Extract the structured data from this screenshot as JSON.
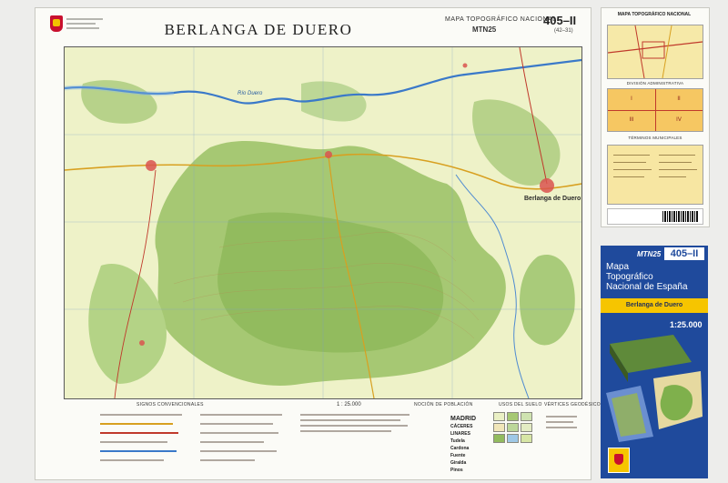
{
  "header": {
    "title": "BERLANGA DE DUERO",
    "series": "MAPA TOPOGRÁFICO NACIONAL",
    "series_code": "MTN25",
    "sheet_number": "405–II",
    "sheet_sub": "(42–31)"
  },
  "places": {
    "berlanga": "Berlanga de Duero",
    "duero": "Río Duero"
  },
  "legend": {
    "signs_title": "SIGNOS CONVENCIONALES",
    "scale": "1 : 25.000",
    "population_title": "NOCIÓN DE POBLACIÓN",
    "population_sizes": [
      "MADRID",
      "CÁCERES",
      "LINARES",
      "Tudela",
      "Cardona",
      "Fuente",
      "Giralda",
      "Pinos"
    ],
    "land_use_title": "USOS DEL SUELO",
    "vertices_title": "VÉRTICES GEODÉSICOS"
  },
  "side": {
    "index_title": "MAPA TOPOGRÁFICO NACIONAL",
    "admin_title": "DIVISIÓN ADMINISTRATIVA",
    "admin_quadrants": [
      "I",
      "II",
      "III",
      "IV"
    ],
    "municipal_title": "TÉRMINOS MUNICIPALES"
  },
  "cover": {
    "code": "MTN25",
    "sheet_number": "405–II",
    "line1": "Mapa",
    "line2": "Topográfico",
    "line3": "Nacional de España",
    "sheet_name": "Berlanga de Duero",
    "scale": "1:25.000"
  },
  "colors": {
    "forest": "#9cc26b",
    "farmland": "#eaf0c4",
    "water": "#3a79c9",
    "urban": "#d9534f",
    "cover_blue": "#1f4a9c",
    "cover_yellow": "#f6c500"
  }
}
